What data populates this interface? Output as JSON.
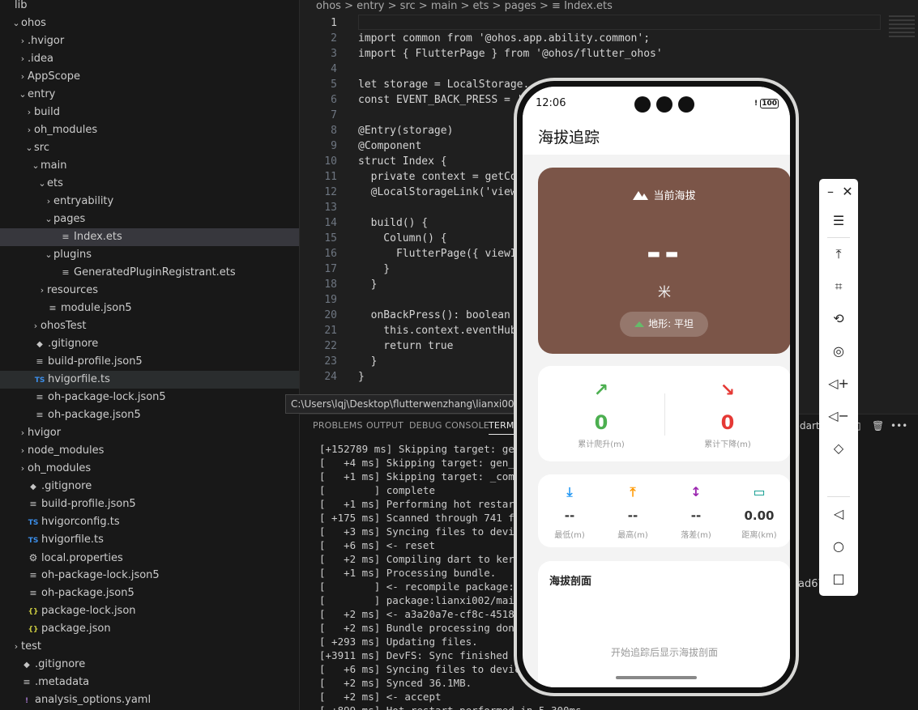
{
  "explorer": {
    "items": [
      {
        "label": "lib",
        "twisty": "",
        "icon": ""
      },
      {
        "label": "ohos",
        "twisty": "v",
        "icon": ""
      },
      {
        "label": ".hvigor",
        "twisty": ">",
        "icon": ""
      },
      {
        "label": ".idea",
        "twisty": ">",
        "icon": ""
      },
      {
        "label": "AppScope",
        "twisty": ">",
        "icon": ""
      },
      {
        "label": "entry",
        "twisty": "v",
        "icon": ""
      },
      {
        "label": "build",
        "twisty": ">",
        "icon": ""
      },
      {
        "label": "oh_modules",
        "twisty": ">",
        "icon": ""
      },
      {
        "label": "src",
        "twisty": "v",
        "icon": ""
      },
      {
        "label": "main",
        "twisty": "v",
        "icon": ""
      },
      {
        "label": "ets",
        "twisty": "v",
        "icon": ""
      },
      {
        "label": "entryability",
        "twisty": ">",
        "icon": ""
      },
      {
        "label": "pages",
        "twisty": "v",
        "icon": ""
      },
      {
        "label": "Index.ets",
        "twisty": "",
        "icon": "lines"
      },
      {
        "label": "plugins",
        "twisty": "v",
        "icon": ""
      },
      {
        "label": "GeneratedPluginRegistrant.ets",
        "twisty": "",
        "icon": "lines"
      },
      {
        "label": "resources",
        "twisty": ">",
        "icon": ""
      },
      {
        "label": "module.json5",
        "twisty": "",
        "icon": "lines"
      },
      {
        "label": "ohosTest",
        "twisty": ">",
        "icon": ""
      },
      {
        "label": ".gitignore",
        "twisty": "",
        "icon": "git"
      },
      {
        "label": "build-profile.json5",
        "twisty": "",
        "icon": "lines"
      },
      {
        "label": "hvigorfile.ts",
        "twisty": "",
        "icon": "ts"
      },
      {
        "label": "oh-package-lock.json5",
        "twisty": "",
        "icon": "lines"
      },
      {
        "label": "oh-package.json5",
        "twisty": "",
        "icon": "lines"
      },
      {
        "label": "hvigor",
        "twisty": ">",
        "icon": ""
      },
      {
        "label": "node_modules",
        "twisty": ">",
        "icon": ""
      },
      {
        "label": "oh_modules",
        "twisty": ">",
        "icon": ""
      },
      {
        "label": ".gitignore",
        "twisty": "",
        "icon": "git"
      },
      {
        "label": "build-profile.json5",
        "twisty": "",
        "icon": "lines"
      },
      {
        "label": "hvigorconfig.ts",
        "twisty": "",
        "icon": "ts"
      },
      {
        "label": "hvigorfile.ts",
        "twisty": "",
        "icon": "ts"
      },
      {
        "label": "local.properties",
        "twisty": "",
        "icon": "gear"
      },
      {
        "label": "oh-package-lock.json5",
        "twisty": "",
        "icon": "lines"
      },
      {
        "label": "oh-package.json5",
        "twisty": "",
        "icon": "lines"
      },
      {
        "label": "package-lock.json",
        "twisty": "",
        "icon": "json"
      },
      {
        "label": "package.json",
        "twisty": "",
        "icon": "json"
      },
      {
        "label": "test",
        "twisty": ">",
        "icon": ""
      },
      {
        "label": ".gitignore",
        "twisty": "",
        "icon": "git"
      },
      {
        "label": ".metadata",
        "twisty": "",
        "icon": "lines"
      },
      {
        "label": "analysis_options.yaml",
        "twisty": "",
        "icon": "yaml"
      }
    ]
  },
  "breadcrumb": {
    "parts": [
      "ohos",
      "entry",
      "src",
      "main",
      "ets",
      "pages"
    ],
    "file": "Index.ets",
    "sep": ">"
  },
  "editor": {
    "lines": [
      "",
      "import common from '@ohos.app.ability.common';",
      "import { FlutterPage } from '@ohos/flutter_ohos'",
      "",
      "let storage = LocalStorage.",
      "const EVENT_BACK_PRESS = '",
      "",
      "@Entry(storage)",
      "@Component",
      "struct Index {",
      "  private context = getCo",
      "  @LocalStorageLink('view",
      "",
      "  build() {",
      "    Column() {",
      "      FlutterPage({ viewI",
      "    }",
      "  }",
      "",
      "  onBackPress(): boolean",
      "    this.context.eventHub",
      "    return true",
      "  }",
      "}"
    ],
    "line_numbers": [
      "1",
      "2",
      "3",
      "4",
      "5",
      "6",
      "7",
      "8",
      "9",
      "10",
      "11",
      "12",
      "13",
      "14",
      "15",
      "16",
      "17",
      "18",
      "19",
      "20",
      "21",
      "22",
      "23",
      "24"
    ]
  },
  "path_tooltip": "C:\\Users\\lqj\\Desktop\\flutterwenzhang\\lianxi002\\ohos",
  "panel": {
    "tabs": [
      "PROBLEMS",
      "OUTPUT",
      "DEBUG CONSOLE",
      "TERMI"
    ],
    "terminal_name": "dart",
    "terminal_lines": [
      "[+152789 ms] Skipping target: gen_",
      "[   +4 ms] Skipping target: gen_da",
      "[   +1 ms] Skipping target: _compo",
      "[        ] complete",
      "[   +1 ms] Performing hot restart.",
      "[ +175 ms] Scanned through 741 fil",
      "[   +3 ms] Syncing files to device",
      "[   +6 ms] <- reset",
      "[   +2 ms] Compiling dart to kerne",
      "[   +1 ms] Processing bundle.",
      "[        ] <- recompile package:li",
      "[        ] package:lianxi002/main.",
      "[   +2 ms] <- a3a20a7e-cf8c-4518-b",
      "[   +2 ms] Bundle processing done.",
      "[ +293 ms] Updating files.",
      "[+3911 ms] DevFS: Sync finished",
      "[   +6 ms] Syncing files to device",
      "[   +2 ms] Synced 36.1MB.",
      "[   +2 ms] <- accept",
      "[ +899 ms] Hot restart performed in 5,300ms."
    ],
    "overflow_text": "ad67"
  },
  "phone": {
    "status": {
      "time": "12:06",
      "battery": "100"
    },
    "app_title": "海拔追踪",
    "hero": {
      "label": "当前海拔",
      "value": "--",
      "unit": "米",
      "terrain": "地形: 平坦"
    },
    "gain": {
      "value": "0",
      "label": "累计爬升(m)",
      "color": "#4caf50"
    },
    "loss": {
      "value": "0",
      "label": "累计下降(m)",
      "color": "#e53935"
    },
    "stats": [
      {
        "value": "--",
        "label": "最低(m)",
        "color": "#2196f3",
        "icon": "arrow-down-icon"
      },
      {
        "value": "--",
        "label": "最高(m)",
        "color": "#ff9800",
        "icon": "arrow-up-icon"
      },
      {
        "value": "--",
        "label": "落差(m)",
        "color": "#9c27b0",
        "icon": "arrow-updown-icon"
      },
      {
        "value": "0.00",
        "label": "距离(km)",
        "color": "#009688",
        "icon": "ruler-icon"
      }
    ],
    "profile": {
      "title": "海拔剖面",
      "hint": "开始追踪后显示海拔剖面"
    }
  },
  "emulator_toolbar": {
    "tools": [
      "minimize-icon",
      "close-icon",
      "menu-icon",
      "pin-top-icon",
      "crop-icon",
      "rotate-icon",
      "screenshot-icon",
      "volume-up-icon",
      "volume-down-icon",
      "fold-icon",
      "back-icon",
      "home-icon",
      "recents-icon"
    ]
  }
}
